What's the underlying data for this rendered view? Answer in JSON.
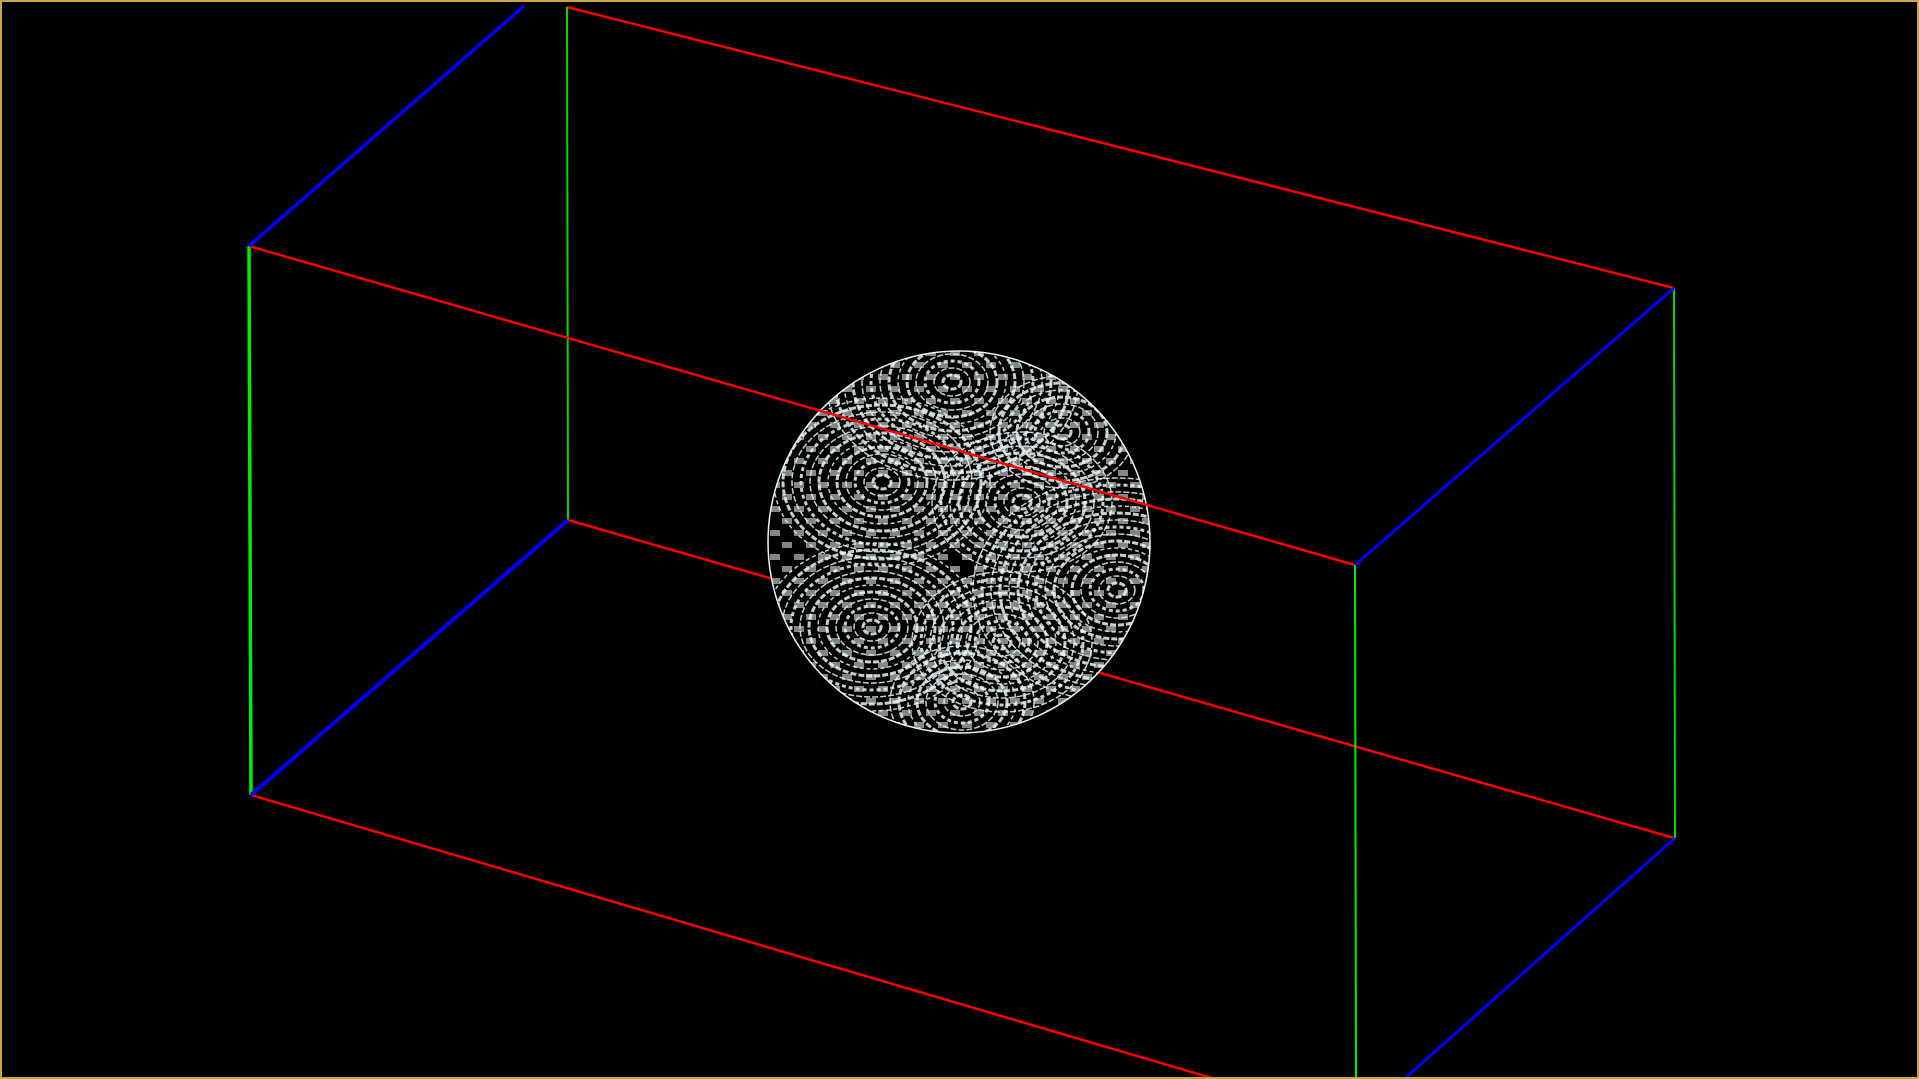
{
  "viewport": {
    "background": "#000000",
    "frame_color": "#c8a83c"
  },
  "scene": {
    "wireframe_box": {
      "edge_colors": {
        "x_axis_edges": "#ff0000",
        "y_axis_edges": "#00ff00",
        "z_axis_edges": "#0000ff"
      }
    },
    "sphere": {
      "fill": "#000000",
      "pattern_color": "#e6f5f5",
      "pattern": "moire-rings-icon"
    }
  }
}
